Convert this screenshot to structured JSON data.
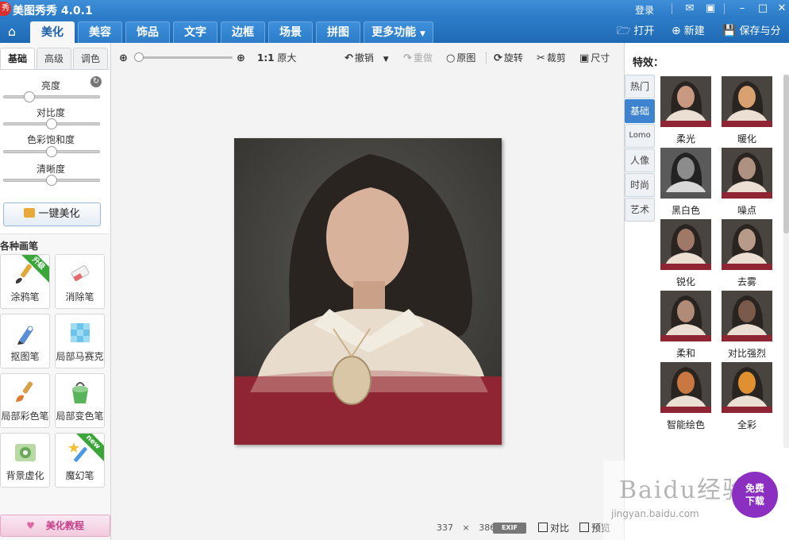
{
  "title_bar": {
    "app_title": "美图秀秀 4.0.1",
    "logo_text": "秀",
    "login": "登录",
    "icons": [
      "message-icon",
      "skin-icon",
      "minimize-icon",
      "maximize-icon",
      "close-icon"
    ]
  },
  "nav": {
    "tabs": [
      {
        "label": "美化",
        "active": true
      },
      {
        "label": "美容"
      },
      {
        "label": "饰品"
      },
      {
        "label": "文字"
      },
      {
        "label": "边框"
      },
      {
        "label": "场景"
      },
      {
        "label": "拼图"
      },
      {
        "label": "更多功能"
      }
    ],
    "open": "打开",
    "new": "新建",
    "save_share": "保存与分享"
  },
  "left_panel": {
    "sub_tabs": [
      "基础",
      "高级",
      "调色"
    ],
    "active_sub_tab": "基础",
    "sliders": [
      {
        "label": "亮度",
        "value": 0.27
      },
      {
        "label": "对比度",
        "value": 0.5
      },
      {
        "label": "色彩饱和度",
        "value": 0.5
      },
      {
        "label": "清晰度",
        "value": 0.5
      }
    ],
    "one_click": "一键美化",
    "brushes_heading": "各种画笔",
    "brushes": [
      {
        "label": "涂鸦笔",
        "badge": "升级",
        "icon": "brush-icon"
      },
      {
        "label": "消除笔",
        "icon": "eraser-icon"
      },
      {
        "label": "抠图笔",
        "icon": "cutout-pen-icon"
      },
      {
        "label": "局部马赛克",
        "icon": "mosaic-icon"
      },
      {
        "label": "局部彩色笔",
        "icon": "color-brush-icon"
      },
      {
        "label": "局部变色笔",
        "icon": "paint-bucket-icon"
      },
      {
        "label": "背景虚化",
        "icon": "blur-icon"
      },
      {
        "label": "魔幻笔",
        "badge": "new",
        "icon": "magic-wand-icon"
      }
    ],
    "tutorial": "美化教程"
  },
  "toolbar": {
    "zoom_value": 0.0,
    "one_to_one": "1:1",
    "original_size": "原大",
    "undo": "撤销",
    "redo": "重做",
    "original": "原图",
    "rotate": "旋转",
    "crop": "裁剪",
    "resize": "尺寸"
  },
  "image": {
    "width": "337",
    "times": "×",
    "height": "386"
  },
  "bottom_bar": {
    "exif": "EXIF",
    "compare": "对比",
    "preview": "预览"
  },
  "right_panel": {
    "title": "特效：",
    "side_tabs": [
      "热门",
      "基础",
      "Lomo",
      "人像",
      "时尚",
      "艺术"
    ],
    "active_side_tab": "基础",
    "effects": [
      {
        "label": "柔光",
        "tint": "#c89880"
      },
      {
        "label": "暖化",
        "tint": "#d9a070"
      },
      {
        "label": "黑白色",
        "tint": "#8c8c8c"
      },
      {
        "label": "噪点",
        "tint": "#b09080"
      },
      {
        "label": "锐化",
        "tint": "#a07868"
      },
      {
        "label": "去雾",
        "tint": "#b89a88"
      },
      {
        "label": "柔和",
        "tint": "#b08c78"
      },
      {
        "label": "对比强烈",
        "tint": "#7a5a48"
      },
      {
        "label": "智能绘色",
        "tint": "#c87840"
      },
      {
        "label": "全彩",
        "tint": "#e09030"
      }
    ]
  },
  "promo": {
    "watermark": "Baidu经验",
    "url": "jingyan.baidu.com",
    "free_download": [
      "免费",
      "下载"
    ]
  },
  "colors": {
    "accent_blue": "#2a79c6",
    "active_tab_text": "#1b5fa7",
    "tutorial_pink": "#c5408a",
    "dress_red": "#8f2433"
  }
}
